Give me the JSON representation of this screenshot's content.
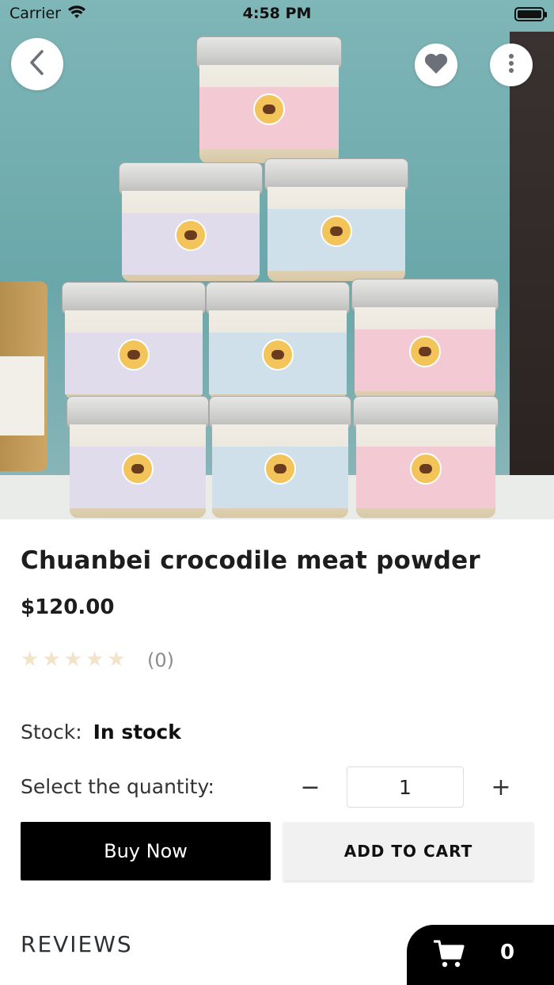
{
  "status_bar": {
    "carrier": "Carrier",
    "time": "4:58 PM"
  },
  "hero": {
    "back_icon": "chevron-left-icon",
    "favorite_icon": "heart-icon",
    "more_icon": "more-vertical-icon"
  },
  "product": {
    "title": "Chuanbei crocodile meat powder",
    "price": "$120.00",
    "rating_stars": 0,
    "rating_count_text": "(0)",
    "stock_label": "Stock:",
    "stock_value": "In stock"
  },
  "quantity": {
    "label": "Select the quantity:",
    "minus": "−",
    "value": "1",
    "plus": "+"
  },
  "actions": {
    "buy_now": "Buy Now",
    "add_to_cart": "ADD TO CART"
  },
  "reviews": {
    "heading": "REVIEWS"
  },
  "cart": {
    "count": "0"
  },
  "colors": {
    "star_empty": "#f3e3c9",
    "buy_bg": "#000000",
    "cart_bg": "#f1f1f1"
  }
}
